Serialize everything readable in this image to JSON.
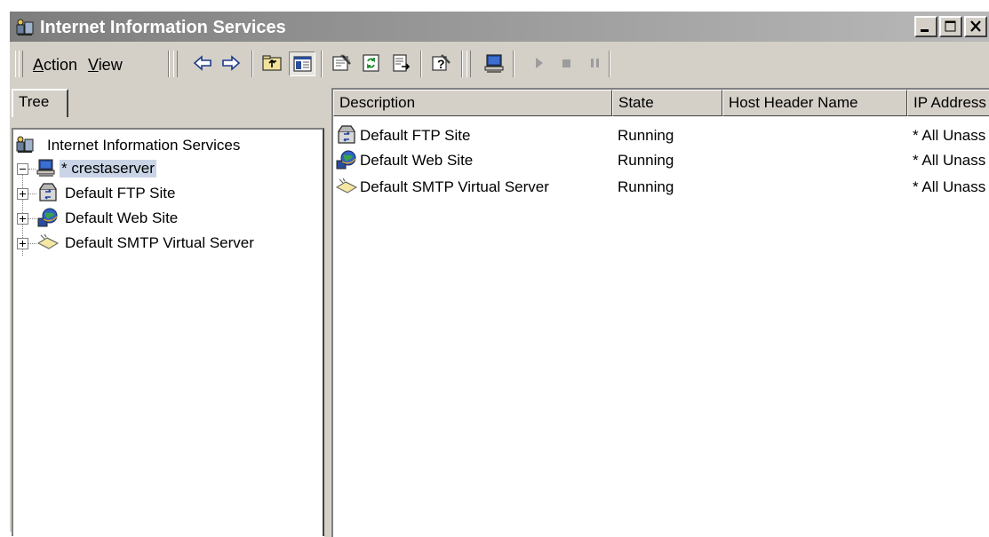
{
  "window": {
    "title": "Internet Information Services"
  },
  "toolbar": {
    "menus": [
      {
        "label": "Action",
        "underline": "A",
        "rest": "ction"
      },
      {
        "label": "View",
        "underline": "V",
        "rest": "iew"
      }
    ],
    "icons": [
      "back-arrow-icon",
      "forward-arrow-icon",
      "up-folder-icon",
      "show-hide-tree-icon",
      "properties-icon",
      "refresh-icon",
      "export-list-icon",
      "help-icon",
      "computer-icon",
      "start-icon",
      "stop-icon",
      "pause-icon"
    ]
  },
  "tree": {
    "tab_label": "Tree",
    "root_label": "Internet Information Services",
    "server_label": "* crestaserver",
    "children": [
      {
        "label": "Default FTP Site",
        "icon": "ftp-site-icon"
      },
      {
        "label": "Default Web Site",
        "icon": "web-site-icon"
      },
      {
        "label": "Default SMTP Virtual Server",
        "icon": "smtp-server-icon"
      }
    ]
  },
  "list": {
    "columns": [
      "Description",
      "State",
      "Host Header Name",
      "IP Address"
    ],
    "rows": [
      {
        "description": "Default FTP Site",
        "state": "Running",
        "host_header": "",
        "ip": "* All Unass",
        "icon": "ftp-site-icon"
      },
      {
        "description": "Default Web Site",
        "state": "Running",
        "host_header": "",
        "ip": "* All Unass",
        "icon": "web-site-icon"
      },
      {
        "description": "Default SMTP Virtual Server",
        "state": "Running",
        "host_header": "",
        "ip": "* All Unass",
        "icon": "smtp-server-icon"
      }
    ]
  },
  "colors": {
    "titlebar_start": "#7d7d7d",
    "titlebar_end": "#b9b9b9",
    "face": "#d4d0c8",
    "selection": "#c9d5e6"
  }
}
